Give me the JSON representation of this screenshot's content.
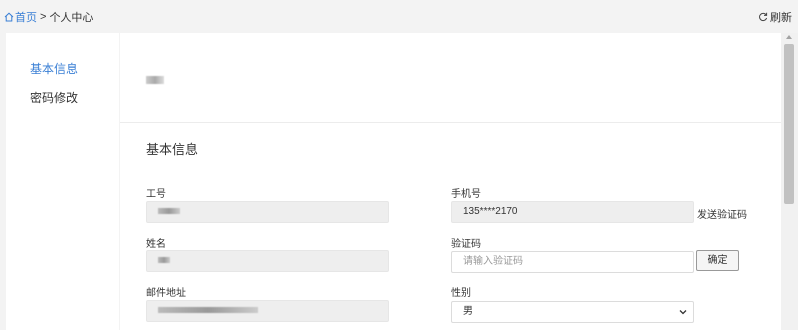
{
  "breadcrumb": {
    "home": "首页",
    "separator": ">",
    "current": "个人中心"
  },
  "toolbar": {
    "refresh_label": "刷新"
  },
  "sidebar": {
    "items": [
      {
        "label": "基本信息",
        "active": true
      },
      {
        "label": "密码修改",
        "active": false
      }
    ]
  },
  "main": {
    "section_title": "基本信息",
    "fields": {
      "employee_id_label": "工号",
      "name_label": "姓名",
      "email_label": "邮件地址",
      "phone_label": "手机号",
      "phone_value": "135****2170",
      "code_label": "验证码",
      "code_placeholder": "请输入验证码",
      "gender_label": "性别",
      "gender_value": "男"
    },
    "send_code_label": "发送验证码",
    "confirm_label": "确定"
  },
  "colors": {
    "accent": "#3a7fd5",
    "readonly_field": "#eeeeee"
  }
}
